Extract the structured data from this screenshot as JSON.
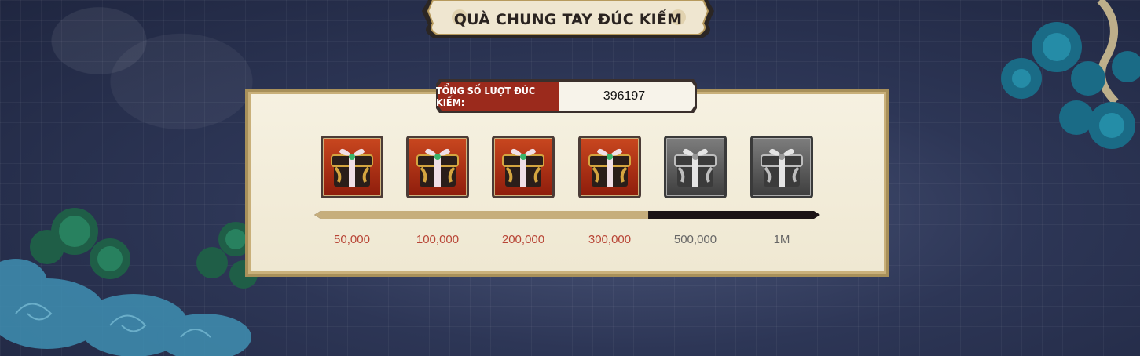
{
  "event": {
    "title": "QUÀ CHUNG TAY ĐÚC KIẾM"
  },
  "counter": {
    "label": "TỔNG SỐ LƯỢT ĐÚC KIẾM:",
    "value": "396197"
  },
  "progress": {
    "fill_fraction": 0.66
  },
  "rewards": [
    {
      "milestone": "50,000",
      "state": "reached",
      "icon": "gift-chest-icon"
    },
    {
      "milestone": "100,000",
      "state": "reached",
      "icon": "gift-chest-icon"
    },
    {
      "milestone": "200,000",
      "state": "reached",
      "icon": "gift-chest-icon"
    },
    {
      "milestone": "300,000",
      "state": "reached",
      "icon": "gift-chest-icon"
    },
    {
      "milestone": "500,000",
      "state": "locked",
      "icon": "gift-chest-icon"
    },
    {
      "milestone": "1M",
      "state": "locked",
      "icon": "gift-chest-icon"
    }
  ],
  "colors": {
    "reached_text": "#b84536",
    "locked_text": "#666666",
    "counter_label_bg": "#9b2a1c",
    "progress_fill": "#c6ae7c",
    "progress_track": "#1c1416"
  }
}
